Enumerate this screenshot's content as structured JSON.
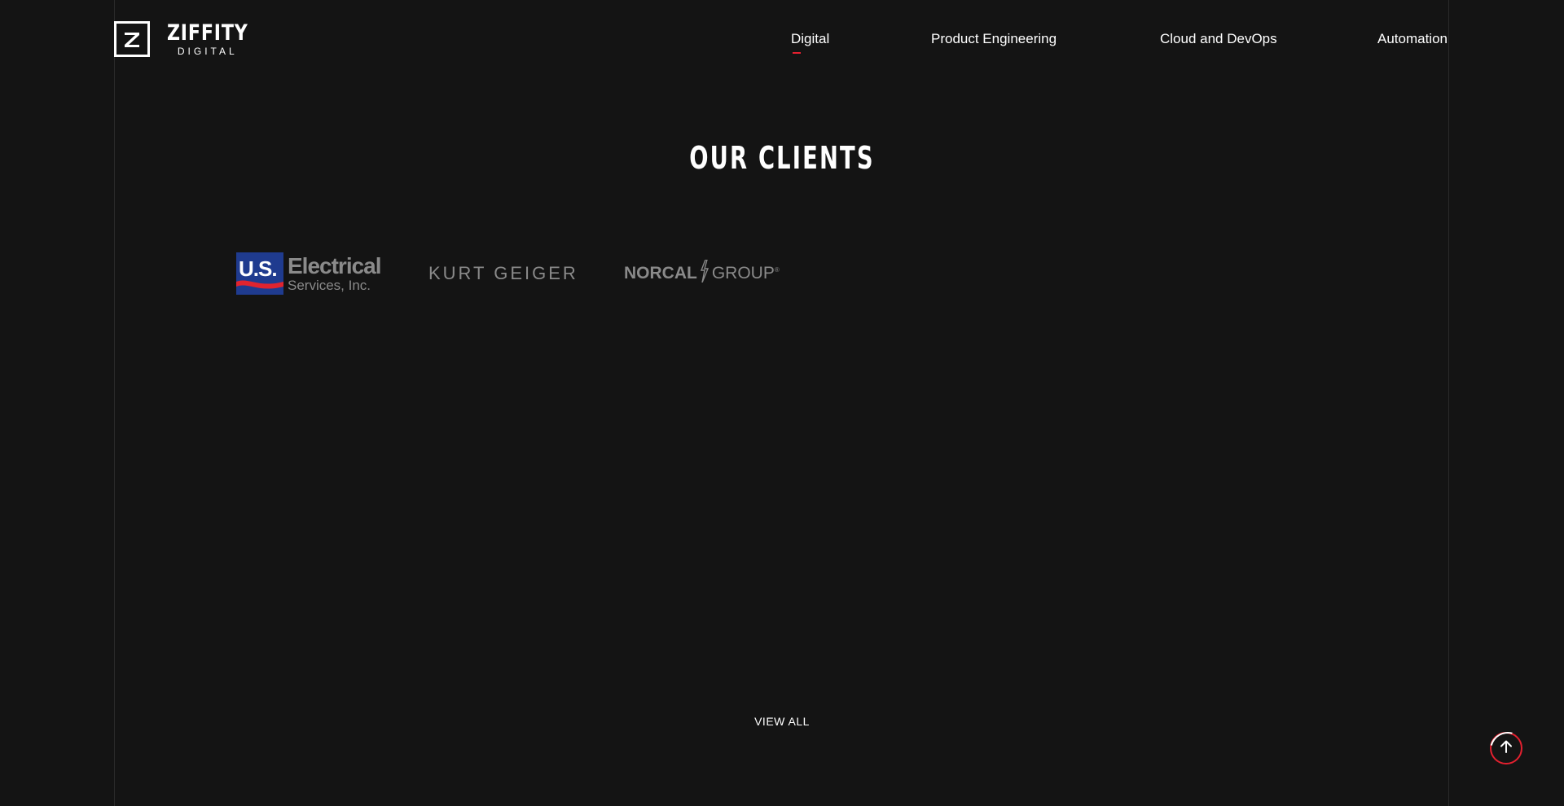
{
  "header": {
    "logo": {
      "word": "ZIFFITY",
      "sub": "DIGITAL",
      "icon": "z-logo-icon"
    },
    "nav": [
      {
        "label": "Digital",
        "active": true
      },
      {
        "label": "Product Engineering",
        "active": false
      },
      {
        "label": "Cloud and DevOps",
        "active": false
      },
      {
        "label": "Automation",
        "active": false
      }
    ]
  },
  "main": {
    "section_title": "OUR CLIENTS",
    "clients": [
      {
        "badge": "U.S.",
        "title": "Electrical",
        "subtitle": "Services, Inc."
      },
      {
        "name": "KURT GEIGER"
      },
      {
        "bold": "NORCAL",
        "light": "GROUP",
        "reg": "®"
      }
    ],
    "view_all_label": "VIEW ALL"
  },
  "scroll_top": {
    "icon": "arrow-up-icon"
  },
  "colors": {
    "background": "#141414",
    "accent": "#e4202f",
    "text": "#ffffff",
    "logo_gray": "#8a8a8a",
    "us_blue": "#1f3b8f",
    "us_red": "#e0242f"
  }
}
